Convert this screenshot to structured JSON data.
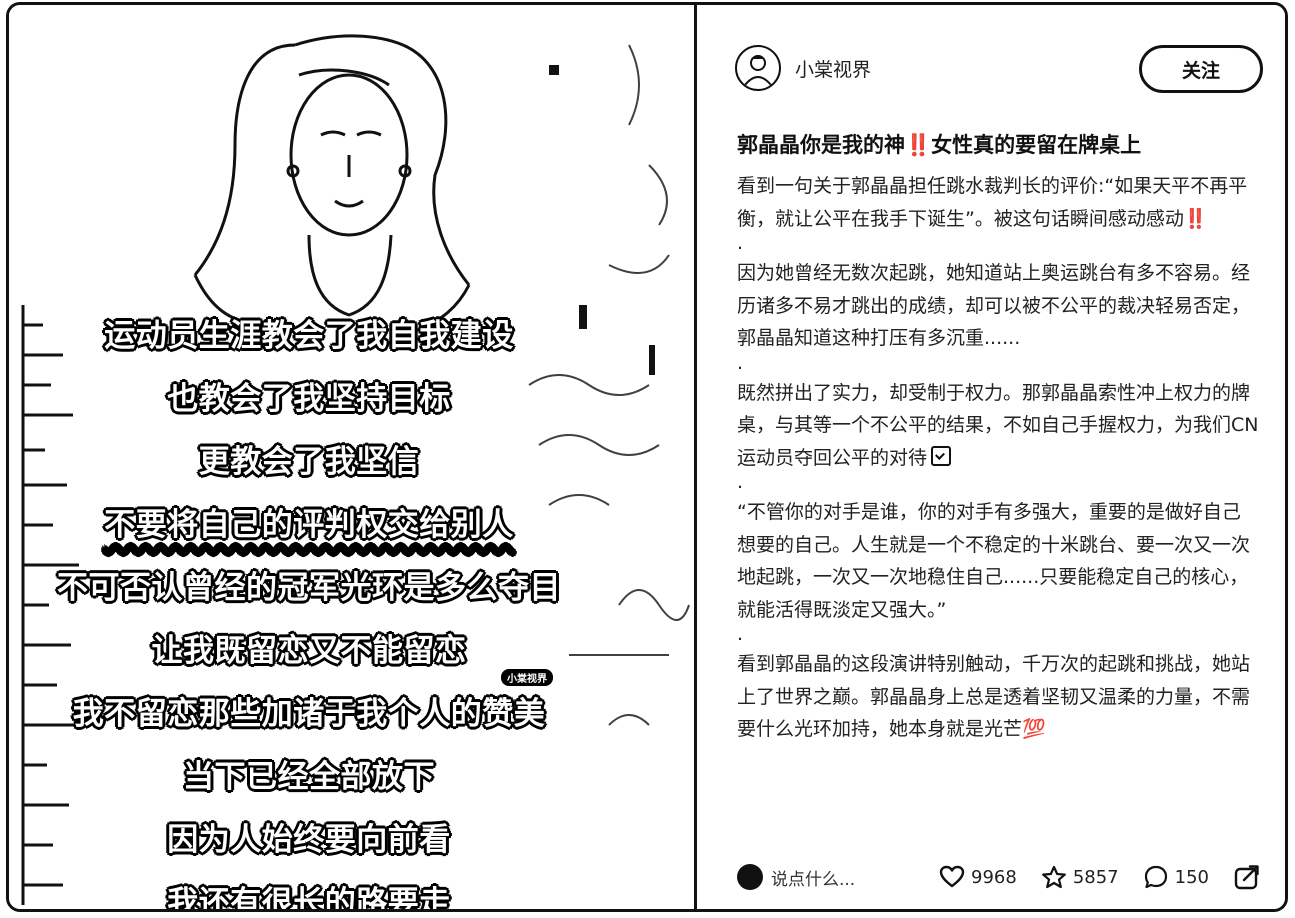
{
  "media": {
    "subtitles": [
      "运动员生涯教会了我自我建设",
      "也教会了我坚持目标",
      "更教会了我坚信",
      "不要将自己的评判权交给别人",
      "不可否认曾经的冠军光环是多么夺目",
      "让我既留恋又不能留恋",
      "我不留恋那些加诸于我个人的赞美",
      "当下已经全部放下",
      "因为人始终要向前看",
      "我还有很长的路要走"
    ],
    "watermark": "小棠视界"
  },
  "post": {
    "author_name": "小棠视界",
    "follow_label": "关注",
    "title": "郭晶晶你是我的神‼️女性真的要留在牌桌上",
    "paragraphs": [
      "看到一句关于郭晶晶担任跳水裁判长的评价:“如果天平不再平衡，就让公平在我手下诞生”。被这句话瞬间感动感动‼️",
      "因为她曾经无数次起跳，她知道站上奥运跳台有多不容易。经历诸多不易才跳出的成绩，却可以被不公平的裁决轻易否定，郭晶晶知道这种打压有多沉重......",
      "既然拼出了实力，却受制于权力。那郭晶晶索性冲上权力的牌桌，与其等一个不公平的结果，不如自己手握权力，为我们CN运动员夺回公平的对待",
      "“不管你的对手是谁，你的对手有多强大，重要的是做好自己想要的自己。人生就是一个不稳定的十米跳台、要一次又一次地起跳，一次又一次地稳住自己......只要能稳定自己的核心，就能活得既淡定又强大。”",
      "看到郭晶晶的这段演讲特别触动，千万次的起跳和挑战，她站上了世界之巅。郭晶晶身上总是透着坚韧又温柔的力量，不需要什么光环加持，她本身就是光芒💯"
    ],
    "separator": ".",
    "comment_placeholder": "说点什么...",
    "likes": "9968",
    "collects": "5857",
    "comments": "150"
  },
  "icons": {
    "like": "heart-icon",
    "collect": "star-icon",
    "comment": "comment-bubble-icon",
    "share": "share-icon",
    "check": "checkbox-icon"
  }
}
